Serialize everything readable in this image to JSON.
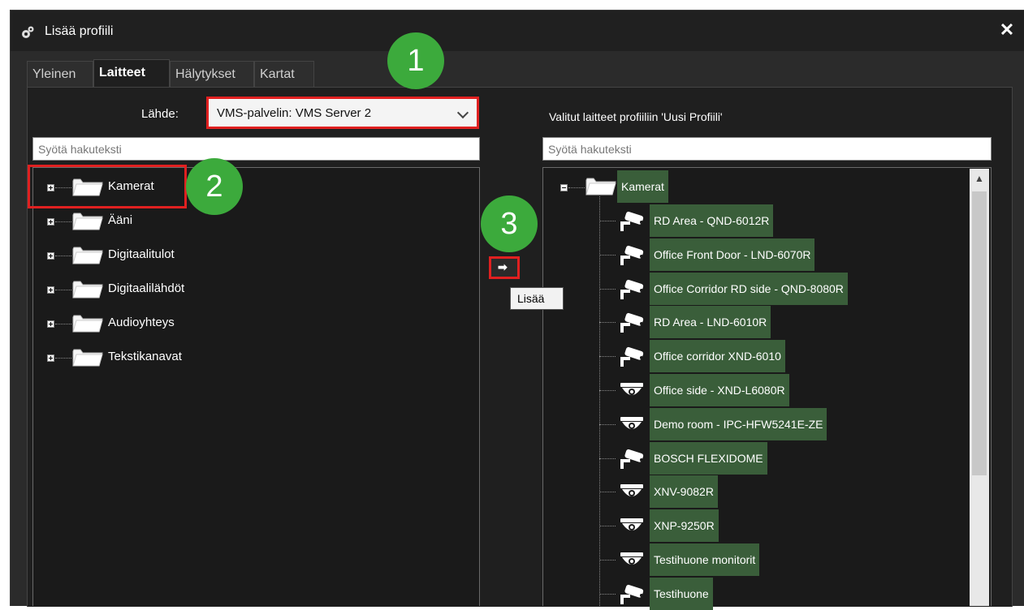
{
  "window": {
    "title": "Lisää profiili",
    "close_glyph": "✕"
  },
  "tabs": [
    {
      "label": "Yleinen",
      "active": false
    },
    {
      "label": "Laitteet",
      "active": true
    },
    {
      "label": "Hälytykset",
      "active": false
    },
    {
      "label": "Kartat",
      "active": false
    }
  ],
  "source": {
    "label": "Lähde:",
    "value": "VMS-palvelin: VMS Server 2"
  },
  "left": {
    "search_placeholder": "Syötä hakuteksti",
    "tree": [
      "Kamerat",
      "Ääni",
      "Digitaalitulot",
      "Digitaalilähdöt",
      "Audioyhteys",
      "Tekstikanavat"
    ]
  },
  "right": {
    "title": "Valitut laitteet profiiliin 'Uusi Profiili'",
    "search_placeholder": "Syötä hakuteksti",
    "root": "Kamerat",
    "cameras": [
      {
        "label": "RD Area - QND-6012R",
        "icon": "bullet-camera-icon"
      },
      {
        "label": "Office Front Door - LND-6070R",
        "icon": "bullet-camera-icon"
      },
      {
        "label": "Office Corridor RD side - QND-8080R",
        "icon": "bullet-camera-icon"
      },
      {
        "label": "RD Area - LND-6010R",
        "icon": "bullet-camera-icon"
      },
      {
        "label": "Office corridor XND-6010",
        "icon": "bullet-camera-icon"
      },
      {
        "label": "Office side - XND-L6080R",
        "icon": "dome-camera-icon"
      },
      {
        "label": "Demo room - IPC-HFW5241E-ZE",
        "icon": "dome-camera-icon"
      },
      {
        "label": "BOSCH FLEXIDOME",
        "icon": "bullet-camera-icon"
      },
      {
        "label": "XNV-9082R",
        "icon": "dome-camera-icon"
      },
      {
        "label": "XNP-9250R",
        "icon": "dome-camera-icon"
      },
      {
        "label": "Testihuone monitorit",
        "icon": "dome-camera-icon"
      },
      {
        "label": "Testihuone",
        "icon": "bullet-camera-icon"
      }
    ]
  },
  "add_button": {
    "glyph": "➡",
    "tooltip": "Lisää"
  },
  "steps": [
    "1",
    "2",
    "3"
  ],
  "colors": {
    "badge": "#3caa3c",
    "highlight": "#e02020",
    "selected": "#3a5e3a"
  }
}
